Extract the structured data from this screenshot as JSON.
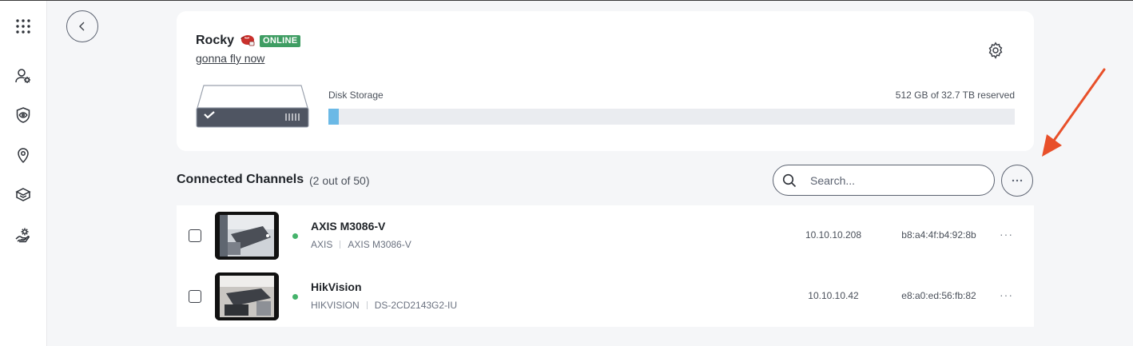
{
  "device": {
    "name": "Rocky",
    "status": "ONLINE",
    "description": "gonna fly now",
    "icon": "boxing-glove-icon",
    "colors": {
      "online": "#3f9d63",
      "disk_fill": "#6bb9e6"
    }
  },
  "disk": {
    "label": "Disk Storage",
    "value": "512 GB of 32.7 TB reserved",
    "reserved_fraction": 0.015
  },
  "channels": {
    "title": "Connected Channels",
    "count": "(2 out of 50)",
    "search_placeholder": "Search...",
    "rows": [
      {
        "name": "AXIS M3086-V",
        "brand": "AXIS",
        "model": "AXIS M3086-V",
        "ip": "10.10.10.208",
        "mac": "b8:a4:4f:b4:92:8b",
        "more": "···",
        "status": "online"
      },
      {
        "name": "HikVision",
        "brand": "HIKVISION",
        "model": "DS-2CD2143G2-IU",
        "ip": "10.10.10.42",
        "mac": "e8:a0:ed:56:fb:82",
        "more": "···",
        "status": "online"
      }
    ]
  },
  "more_button": "···",
  "sidebar": {
    "items": [
      {
        "icon": "apps-grid-icon"
      },
      {
        "icon": "user-settings-icon"
      },
      {
        "icon": "shield-eye-icon"
      },
      {
        "icon": "location-pin-icon"
      },
      {
        "icon": "box-stack-icon"
      },
      {
        "icon": "hand-settings-icon"
      }
    ]
  },
  "annotation": {
    "arrow_color": "#e8502a"
  }
}
